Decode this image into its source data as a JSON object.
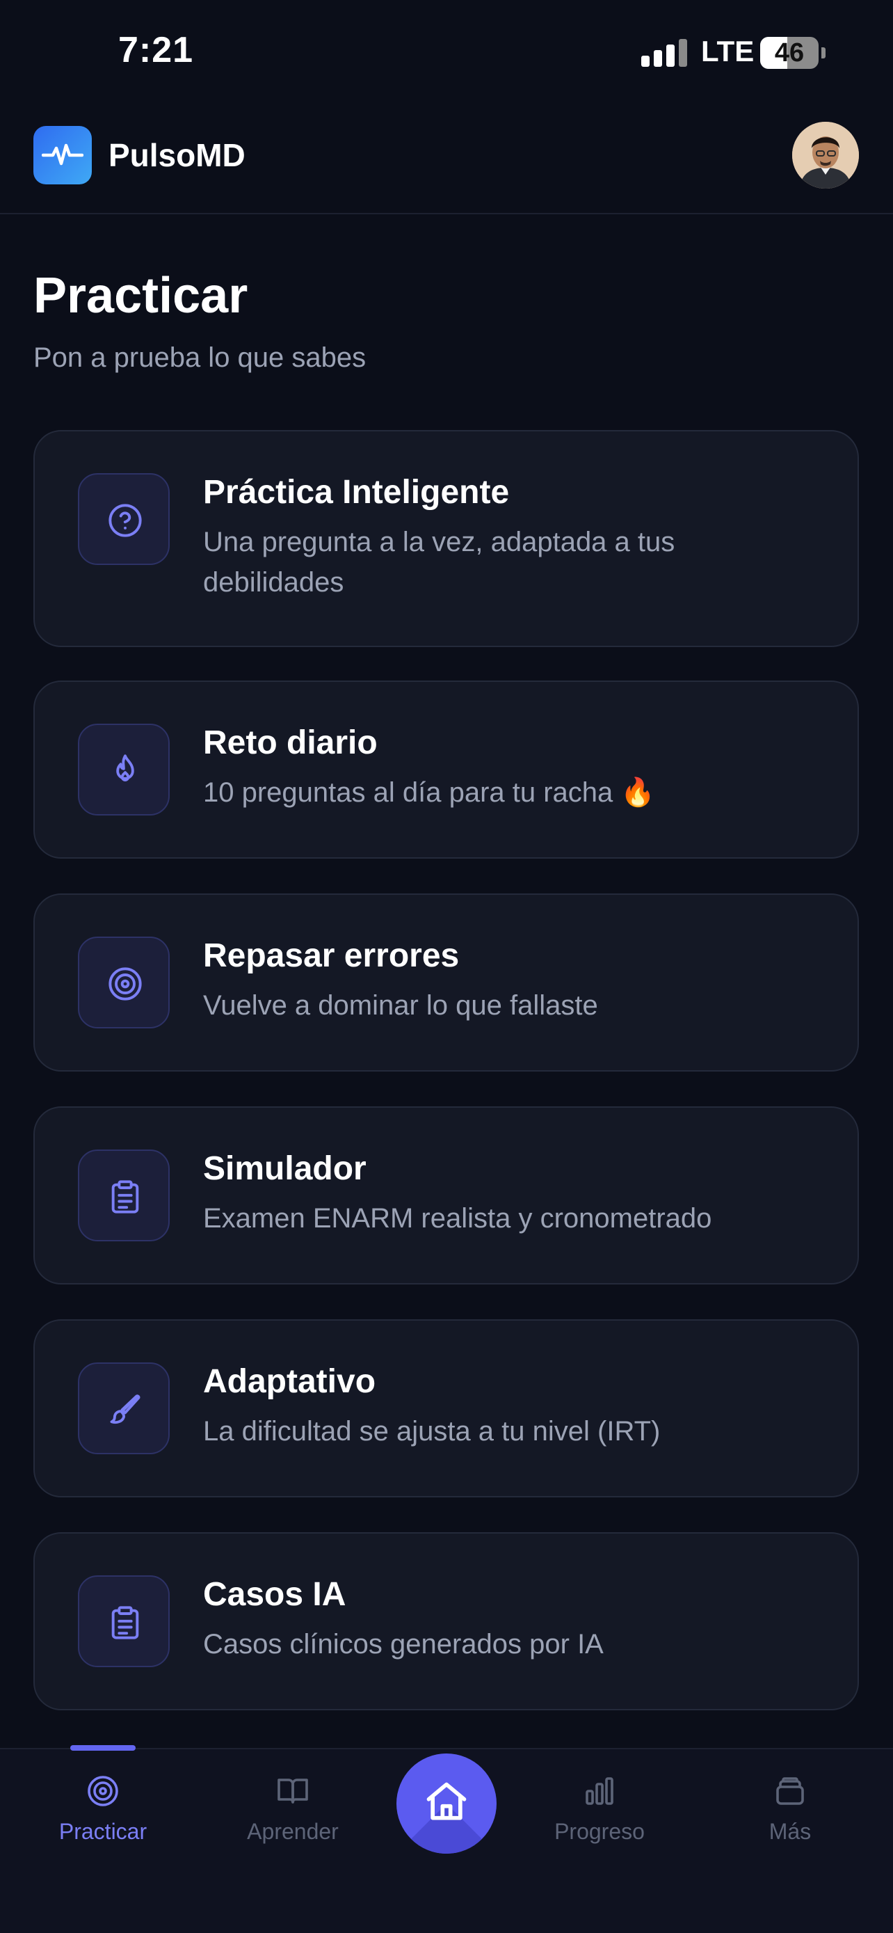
{
  "status_bar": {
    "time": "7:21",
    "network": "LTE",
    "battery": "46",
    "battery_level": 0.46
  },
  "header": {
    "app_name": "PulsoMD",
    "logo_icon": "pulse-icon",
    "avatar_icon": "user-avatar"
  },
  "page": {
    "title": "Practicar",
    "subtitle": "Pon a prueba lo que sabes"
  },
  "cards": [
    {
      "icon": "question-circle-icon",
      "title": "Práctica Inteligente",
      "description": "Una pregunta a la vez, adaptada a tus debilidades"
    },
    {
      "icon": "flame-icon",
      "title": "Reto diario",
      "description": "10 preguntas al día para tu racha 🔥"
    },
    {
      "icon": "target-icon",
      "title": "Repasar errores",
      "description": "Vuelve a dominar lo que fallaste"
    },
    {
      "icon": "clipboard-icon",
      "title": "Simulador",
      "description": "Examen ENARM realista y cronometrado"
    },
    {
      "icon": "brush-icon",
      "title": "Adaptativo",
      "description": "La dificultad se ajusta a tu nivel (IRT)"
    },
    {
      "icon": "clipboard-icon",
      "title": "Casos IA",
      "description": "Casos clínicos generados por IA"
    }
  ],
  "bottom_nav": {
    "items": [
      {
        "label": "Practicar",
        "icon": "target-icon",
        "active": true
      },
      {
        "label": "Aprender",
        "icon": "book-icon",
        "active": false
      },
      {
        "label": "",
        "icon": "home-icon",
        "active": false
      },
      {
        "label": "Progreso",
        "icon": "bar-chart-icon",
        "active": false
      },
      {
        "label": "Más",
        "icon": "stack-icon",
        "active": false
      }
    ]
  },
  "colors": {
    "background": "#0b0e19",
    "card": "#141825",
    "accent": "#6366f1",
    "muted_text": "#9ca3b5"
  }
}
